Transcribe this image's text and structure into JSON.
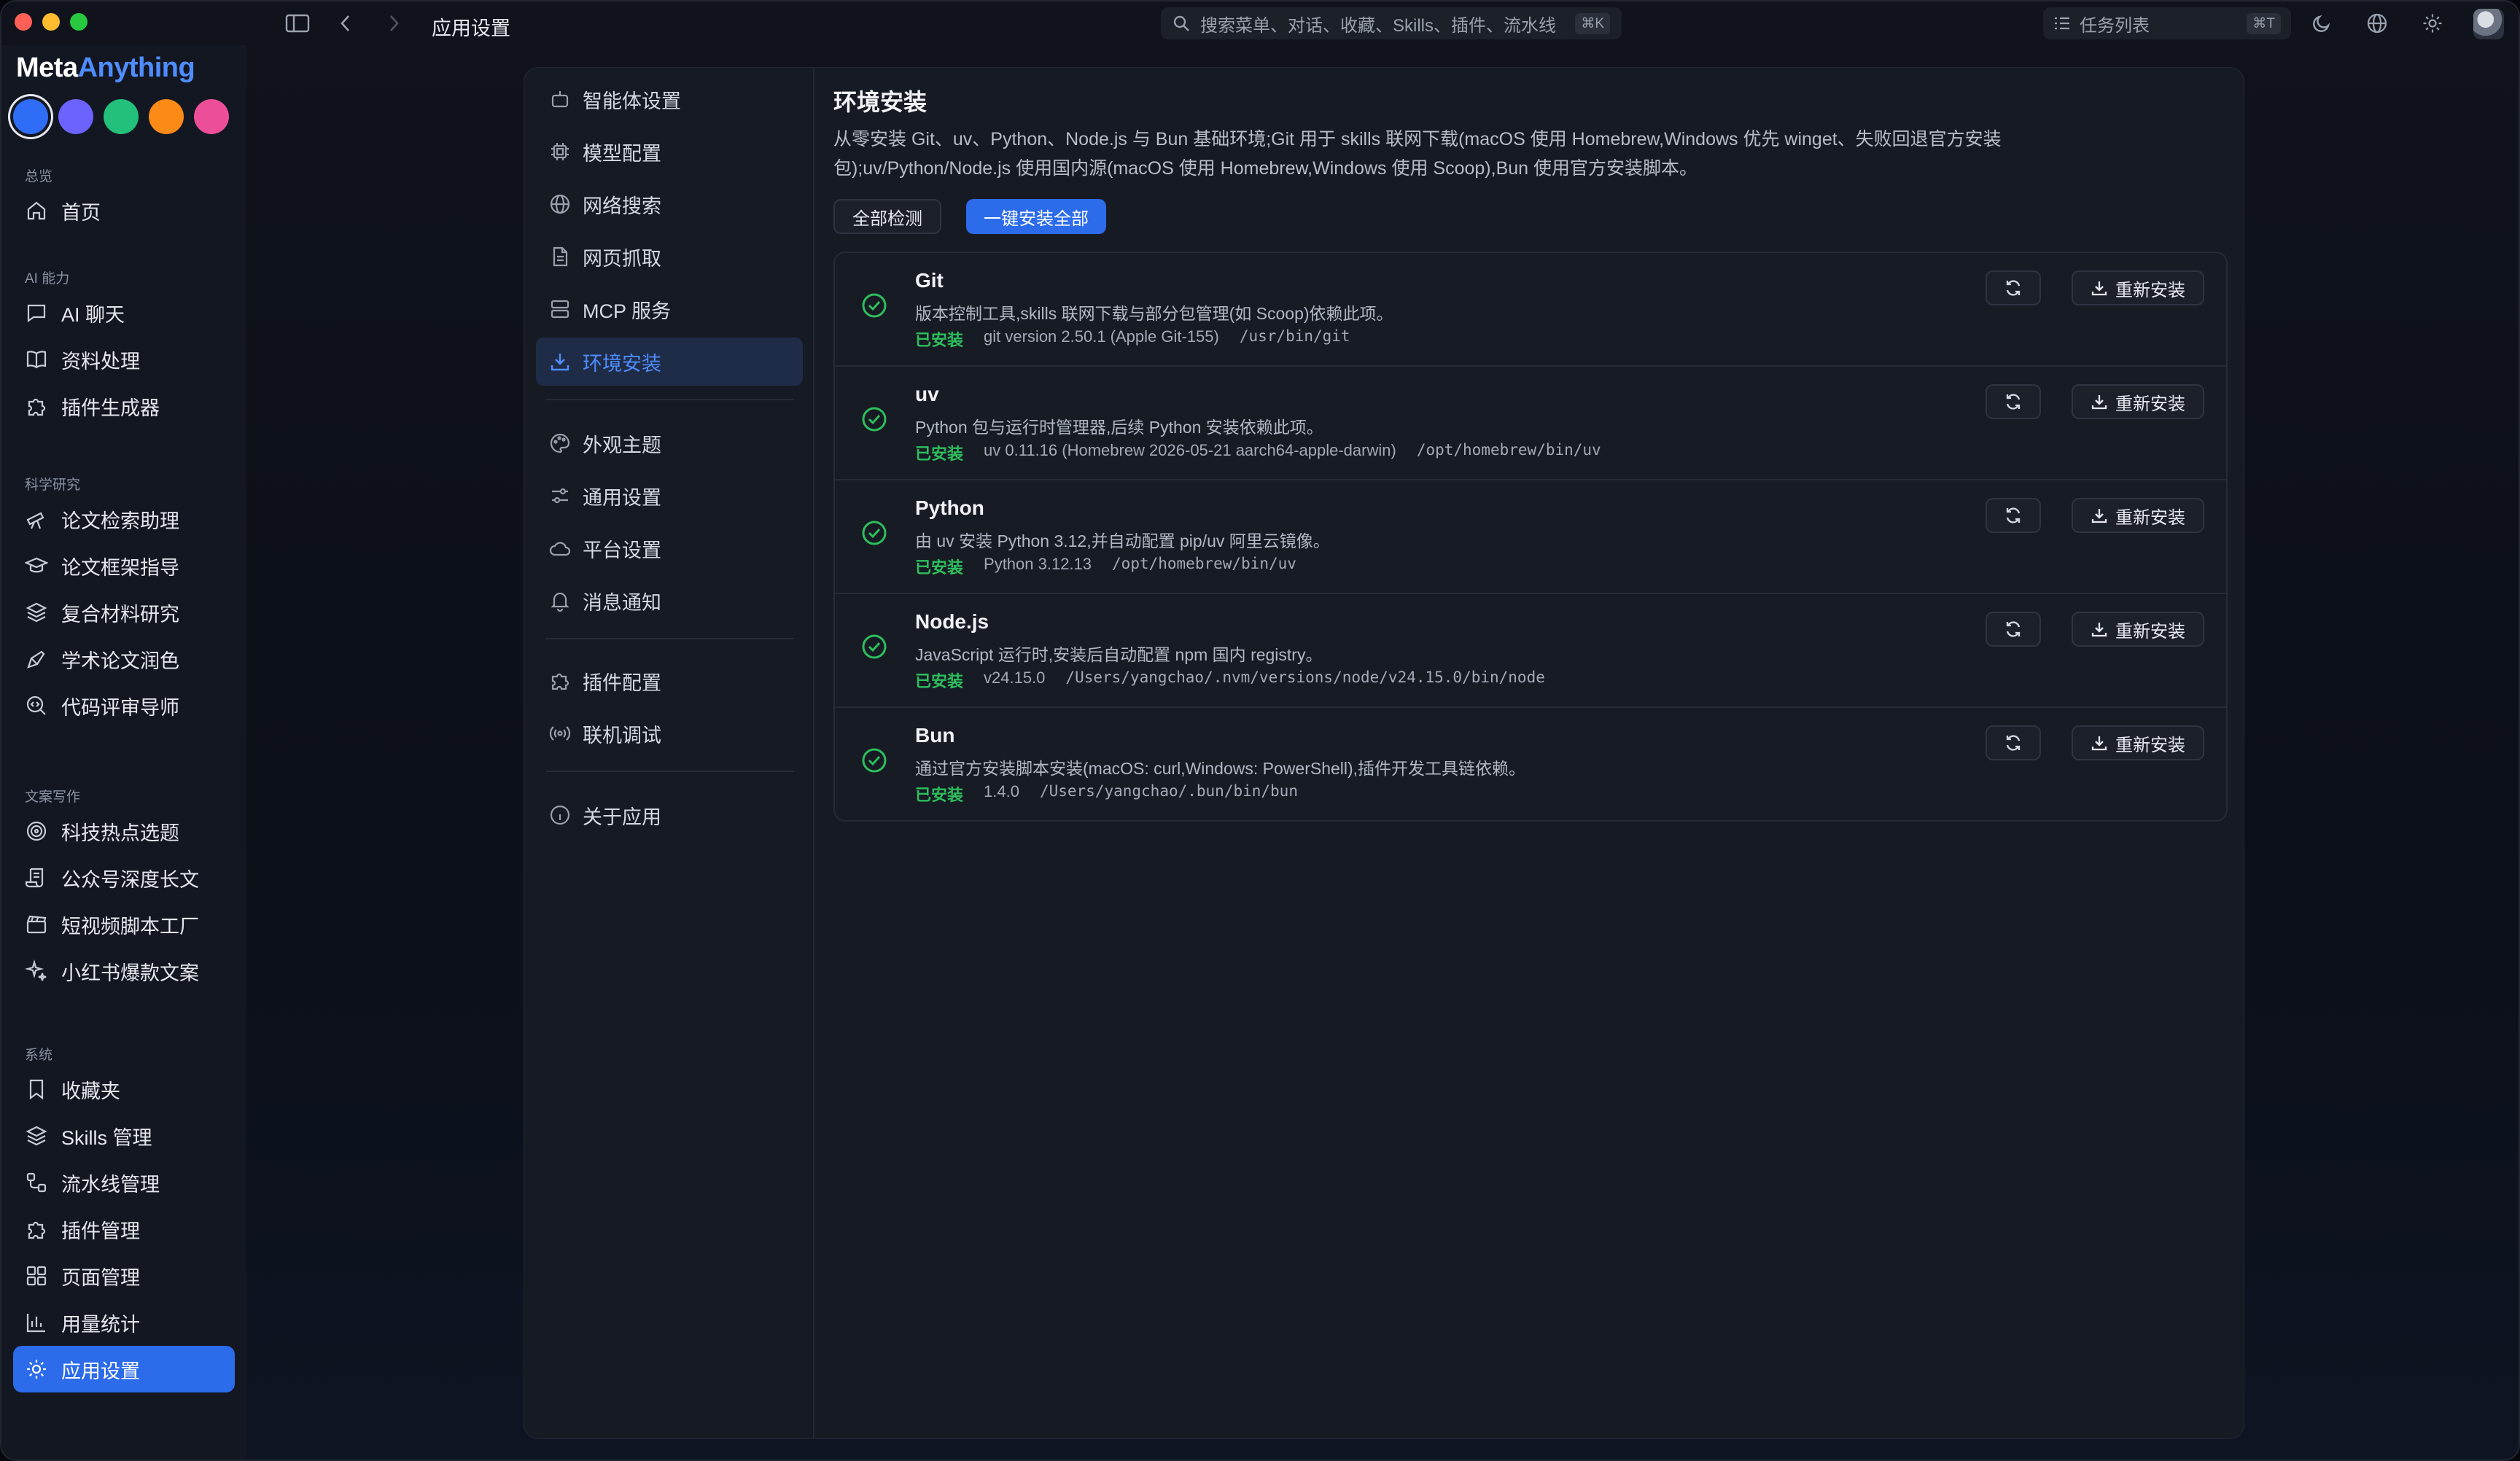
{
  "window": {
    "title": "应用设置"
  },
  "search": {
    "placeholder": "搜索菜单、对话、收藏、Skills、插件、流水线",
    "shortcut": "⌘K"
  },
  "tasks": {
    "label": "任务列表",
    "shortcut": "⌘T"
  },
  "brand": {
    "meta": "Meta",
    "anything": "Anything"
  },
  "theme_colors": [
    "#2f6df6",
    "#6c63ff",
    "#22c07a",
    "#fb8a17",
    "#ec4e9a"
  ],
  "sidebar": {
    "groups": [
      {
        "label": "总览",
        "items": [
          {
            "label": "首页",
            "icon": "home-icon"
          }
        ]
      },
      {
        "label": "AI 能力",
        "items": [
          {
            "label": "AI 聊天",
            "icon": "chat-icon"
          },
          {
            "label": "资料处理",
            "icon": "book-icon"
          },
          {
            "label": "插件生成器",
            "icon": "puzzle-icon"
          }
        ]
      },
      {
        "label": "科学研究",
        "items": [
          {
            "label": "论文检索助理",
            "icon": "telescope-icon"
          },
          {
            "label": "论文框架指导",
            "icon": "graduation-cap-icon"
          },
          {
            "label": "复合材料研究",
            "icon": "layers-icon"
          },
          {
            "label": "学术论文润色",
            "icon": "pen-icon"
          },
          {
            "label": "代码评审导师",
            "icon": "code-search-icon"
          }
        ]
      },
      {
        "label": "文案写作",
        "items": [
          {
            "label": "科技热点选题",
            "icon": "radar-icon"
          },
          {
            "label": "公众号深度长文",
            "icon": "scroll-icon"
          },
          {
            "label": "短视频脚本工厂",
            "icon": "clapperboard-icon"
          },
          {
            "label": "小红书爆款文案",
            "icon": "sparkles-icon"
          }
        ]
      },
      {
        "label": "系统",
        "items": [
          {
            "label": "收藏夹",
            "icon": "bookmark-icon"
          },
          {
            "label": "Skills 管理",
            "icon": "layers-icon"
          },
          {
            "label": "流水线管理",
            "icon": "workflow-icon"
          },
          {
            "label": "插件管理",
            "icon": "puzzle-icon"
          },
          {
            "label": "页面管理",
            "icon": "grid-icon"
          },
          {
            "label": "用量统计",
            "icon": "bar-chart-icon"
          },
          {
            "label": "应用设置",
            "icon": "gear-icon",
            "active": true
          }
        ]
      }
    ]
  },
  "settings_nav": [
    {
      "label": "智能体设置",
      "icon": "robot-icon"
    },
    {
      "label": "模型配置",
      "icon": "cpu-icon"
    },
    {
      "label": "网络搜索",
      "icon": "globe-icon"
    },
    {
      "label": "网页抓取",
      "icon": "file-icon"
    },
    {
      "label": "MCP 服务",
      "icon": "server-icon"
    },
    {
      "label": "环境安装",
      "icon": "download-icon",
      "active": true
    },
    {
      "label": "外观主题",
      "icon": "palette-icon"
    },
    {
      "label": "通用设置",
      "icon": "sliders-icon"
    },
    {
      "label": "平台设置",
      "icon": "cloud-icon"
    },
    {
      "label": "消息通知",
      "icon": "bell-icon"
    },
    {
      "label": "插件配置",
      "icon": "puzzle-icon"
    },
    {
      "label": "联机调试",
      "icon": "broadcast-icon"
    },
    {
      "label": "关于应用",
      "icon": "info-icon"
    }
  ],
  "content": {
    "title": "环境安装",
    "description": "从零安装 Git、uv、Python、Node.js 与 Bun 基础环境;Git 用于 skills 联网下载(macOS 使用 Homebrew,Windows 优先 winget、失败回退官方安装包);uv/Python/Node.js 使用国内源(macOS 使用 Homebrew,Windows 使用 Scoop),Bun 使用官方安装脚本。",
    "check_all_label": "全部检测",
    "install_all_label": "一键安装全部",
    "reinstall_label": "重新安装",
    "status_color": "#2dbf5c",
    "accent_color": "#2c6bea",
    "tools": [
      {
        "name": "Git",
        "description": "版本控制工具,skills 联网下载与部分包管理(如 Scoop)依赖此项。",
        "status": "已安装",
        "version": "git version 2.50.1 (Apple Git-155)",
        "path": "/usr/bin/git"
      },
      {
        "name": "uv",
        "description": "Python 包与运行时管理器,后续 Python 安装依赖此项。",
        "status": "已安装",
        "version": "uv 0.11.16 (Homebrew 2026-05-21 aarch64-apple-darwin)",
        "path": "/opt/homebrew/bin/uv"
      },
      {
        "name": "Python",
        "description": "由 uv 安装 Python 3.12,并自动配置 pip/uv 阿里云镜像。",
        "status": "已安装",
        "version": "Python 3.12.13",
        "path": "/opt/homebrew/bin/uv"
      },
      {
        "name": "Node.js",
        "description": "JavaScript 运行时,安装后自动配置 npm 国内 registry。",
        "status": "已安装",
        "version": "v24.15.0",
        "path": "/Users/yangchao/.nvm/versions/node/v24.15.0/bin/node"
      },
      {
        "name": "Bun",
        "description": "通过官方安装脚本安装(macOS: curl,Windows: PowerShell),插件开发工具链依赖。",
        "status": "已安装",
        "version": "1.4.0",
        "path": "/Users/yangchao/.bun/bin/bun"
      }
    ]
  }
}
